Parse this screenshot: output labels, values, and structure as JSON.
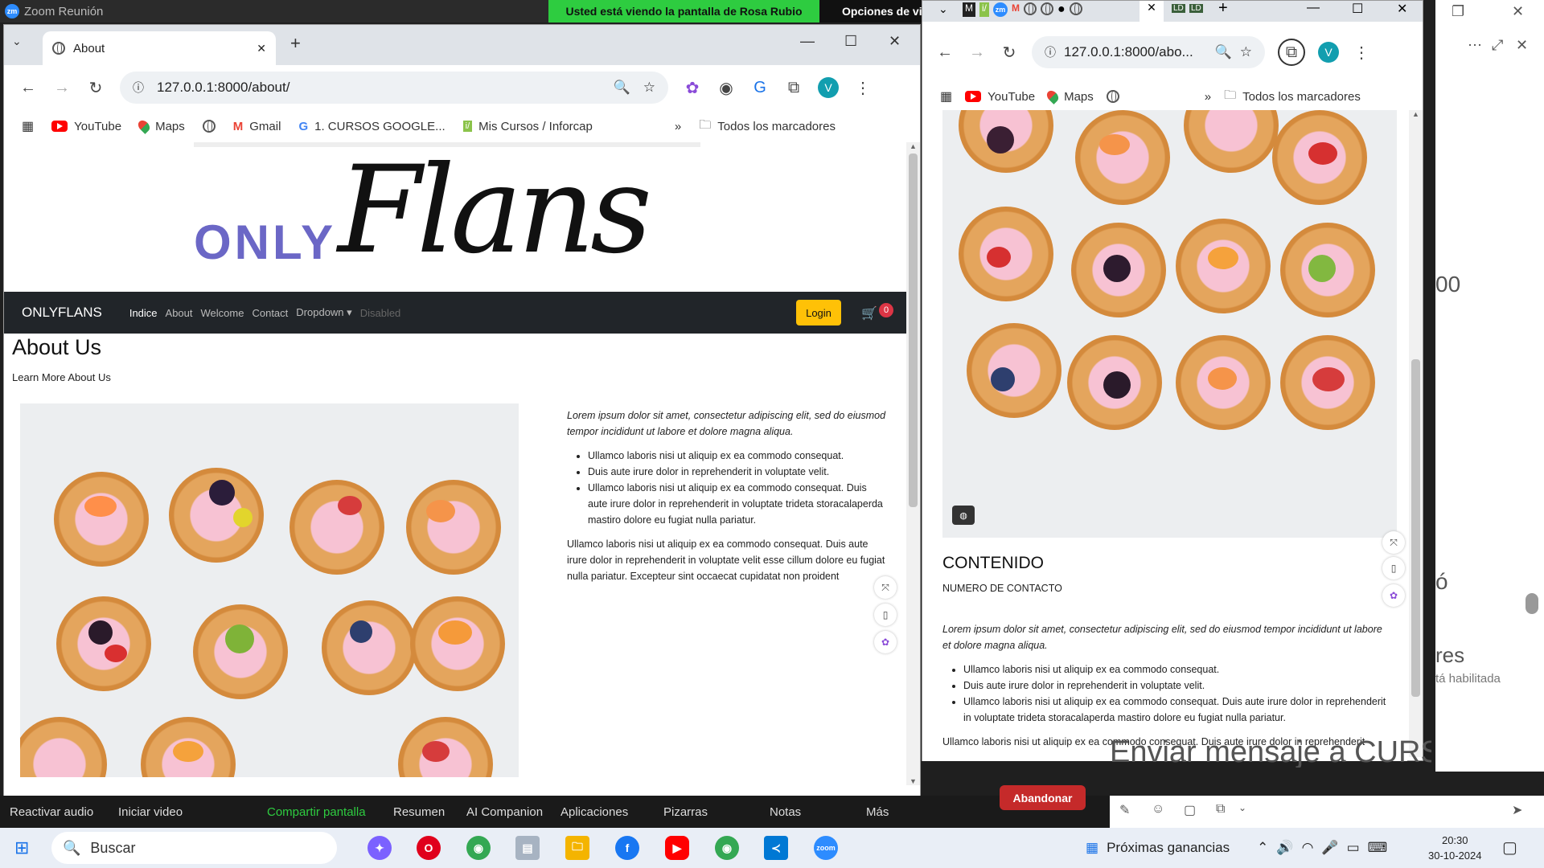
{
  "zoom": {
    "title": "Zoom Reunión",
    "share_banner": "Usted está viendo la pantalla de Rosa Rubio",
    "share_options": "Opciones de vis",
    "side_fragments": [
      "00",
      "ó",
      "res",
      "tá habilitada"
    ],
    "chat_fragment": "Enviar mensaje a CURSO P...",
    "toolbar": [
      "Reactivar audio",
      "Iniciar video",
      "Compartir pantalla",
      "Resumen",
      "AI Companion",
      "Aplicaciones",
      "Pizarras",
      "Notas",
      "Más"
    ],
    "leave": "Abandonar"
  },
  "win1": {
    "tab_title": "About",
    "url": "127.0.0.1:8000/about/",
    "bookmarks": [
      "YouTube",
      "Maps",
      "Gmail",
      "1. CURSOS GOOGLE...",
      "Mis Cursos / Inforcap"
    ],
    "bookmarks_all": "Todos los marcadores",
    "avatar": "V",
    "page": {
      "logo_only": "ONLY",
      "logo_flans": "Flans",
      "brand": "ONLYFLANS",
      "nav": [
        "Indice",
        "About",
        "Welcome",
        "Contact",
        "Dropdown",
        "Disabled"
      ],
      "login": "Login",
      "cart_count": "0",
      "heading": "About Us",
      "subheading": "Learn More About Us",
      "lead": "Lorem ipsum dolor sit amet, consectetur adipiscing elit, sed do eiusmod tempor incididunt ut labore et dolore magna aliqua.",
      "bullets": [
        "Ullamco laboris nisi ut aliquip ex ea commodo consequat.",
        "Duis aute irure dolor in reprehenderit in voluptate velit.",
        "Ullamco laboris nisi ut aliquip ex ea commodo consequat. Duis aute irure dolor in reprehenderit in voluptate trideta storacalaperda mastiro dolore eu fugiat nulla pariatur."
      ],
      "paragraph": "Ullamco laboris nisi ut aliquip ex ea commodo consequat. Duis aute irure dolor in reprehenderit in voluptate velit esse cillum dolore eu fugiat nulla pariatur. Excepteur sint occaecat cupidatat non proident"
    }
  },
  "win2": {
    "url": "127.0.0.1:8000/abo...",
    "bookmarks": [
      "YouTube",
      "Maps"
    ],
    "bookmarks_all": "Todos los marcadores",
    "avatar": "V",
    "page": {
      "heading": "CONTENIDO",
      "subheading": "NUMERO DE CONTACTO",
      "lead": "Lorem ipsum dolor sit amet, consectetur adipiscing elit, sed do eiusmod tempor incididunt ut labore et dolore magna aliqua.",
      "bullets": [
        "Ullamco laboris nisi ut aliquip ex ea commodo consequat.",
        "Duis aute irure dolor in reprehenderit in voluptate velit.",
        "Ullamco laboris nisi ut aliquip ex ea commodo consequat. Duis aute irure dolor in reprehenderit in voluptate trideta storacalaperda mastiro dolore eu fugiat nulla pariatur."
      ],
      "paragraph": "Ullamco laboris nisi ut aliquip ex ea commodo consequat. Duis aute irure dolor in reprehenderit"
    }
  },
  "taskbar": {
    "search": "Buscar",
    "widget": "Próximas ganancias",
    "time": "20:30",
    "date": "30-10-2024"
  }
}
